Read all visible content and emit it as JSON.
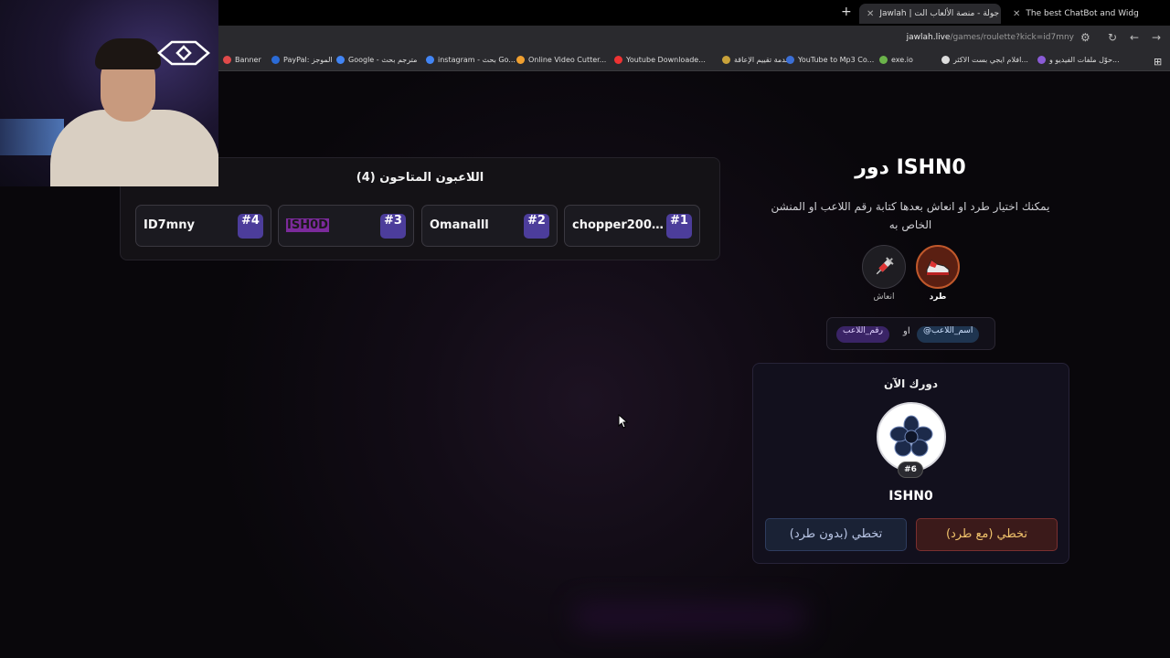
{
  "browser": {
    "tabs": [
      {
        "title": "Jawlah | جولة - منصة الألعاب الت",
        "active": true
      },
      {
        "title": "The best ChatBot and Widg",
        "active": false
      }
    ],
    "url_host": "jawlah.live",
    "url_path": "/games/roulette?kick=id7mny",
    "bookmarks": [
      {
        "label": "Banner",
        "color": "#e04a4a"
      },
      {
        "label": "PayPal: الموجز",
        "color": "#2b6bd6"
      },
      {
        "label": "Google - مترجم بحث",
        "color": "#4285f4"
      },
      {
        "label": "instagram - بحث Go...",
        "color": "#4285f4"
      },
      {
        "label": "Online Video Cutter...",
        "color": "#f0a030"
      },
      {
        "label": "Youtube Downloade...",
        "color": "#e33"
      },
      {
        "label": "خدمة تقييم الإعاقة",
        "color": "#c9a23a"
      },
      {
        "label": "YouTube to Mp3 Co...",
        "color": "#3b6fd6"
      },
      {
        "label": "exe.io",
        "color": "#6bb34a"
      },
      {
        "label": "افلام ايجي بست الاكثر...",
        "color": "#ddd"
      },
      {
        "label": "حوّل ملفات الفيديو و...",
        "color": "#8a5bd6"
      }
    ]
  },
  "players_panel": {
    "title": "اللاعبون المتاحون (4)",
    "players": [
      {
        "num": "#1",
        "name": "chopper200..."
      },
      {
        "num": "#2",
        "name": "Omanalll"
      },
      {
        "num": "#3",
        "name": "ISH0D"
      },
      {
        "num": "#4",
        "name": "ID7mny"
      }
    ]
  },
  "turn": {
    "title": "دور ISHN0",
    "hint": "يمكنك اختيار طرد او انعاش بعدها كتابة رقم اللاعب او المنشن الخاص به",
    "actions": {
      "kick": "طرد",
      "revive": "انعاش"
    },
    "mention_pill": "@اسم_اللاعب",
    "or": "او",
    "number_pill": "رقم_اللاعب"
  },
  "current_card": {
    "label": "دورك الآن",
    "badge": "#6",
    "name": "ISHN0",
    "skip_with_kick": "تخطي (مع طرد)",
    "skip_without_kick": "تخطي (بدون طرد)"
  },
  "colors": {
    "accent": "#4c3d9b",
    "kick": "#c0392b",
    "highlight": "#7b2a9b"
  }
}
